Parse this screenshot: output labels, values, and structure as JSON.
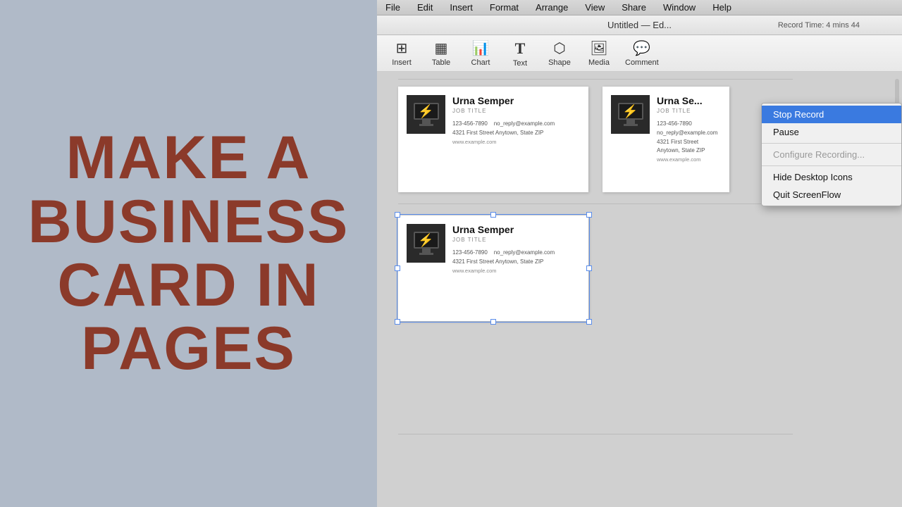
{
  "left_panel": {
    "title_line1": "MAKE A",
    "title_line2": "BUSINESS",
    "title_line3": "CARD IN",
    "title_line4": "PAGES"
  },
  "menu_bar": {
    "items": [
      "File",
      "Edit",
      "Insert",
      "Format",
      "Arrange",
      "View",
      "Share",
      "Window",
      "Help"
    ]
  },
  "title_bar": {
    "text": "Untitled — Ed...",
    "record_time": "Record Time: 4 mins 44"
  },
  "toolbar": {
    "buttons": [
      {
        "label": "Insert",
        "icon": "⊞"
      },
      {
        "label": "Table",
        "icon": "▦"
      },
      {
        "label": "Chart",
        "icon": "📊"
      },
      {
        "label": "Text",
        "icon": "T"
      },
      {
        "label": "Shape",
        "icon": "⬡"
      },
      {
        "label": "Media",
        "icon": "🖼"
      },
      {
        "label": "Comment",
        "icon": "💬"
      }
    ]
  },
  "cards": [
    {
      "name": "Urna Semper",
      "job_title": "JOB TITLE",
      "phone": "123-456-7890",
      "email": "no_reply@example.com",
      "address": "4321 First Street  Anytown, State  ZIP",
      "url": "www.example.com",
      "selected": false
    },
    {
      "name": "Urna Se...",
      "job_title": "JOB TITLE",
      "phone": "123-456-7890",
      "email": "no_reply@example.com",
      "address": "4321 First Street  Anytown, State  ZIP",
      "url": "www.example.com",
      "selected": false
    },
    {
      "name": "Urna Semper",
      "job_title": "JOB TITLE",
      "phone": "123-456-7890",
      "email": "no_reply@example.com",
      "address": "4321 First Street  Anytown, State  ZIP",
      "url": "www.example.com",
      "selected": true
    }
  ],
  "dropdown": {
    "items": [
      {
        "label": "Stop Record",
        "type": "highlighted"
      },
      {
        "label": "Pause",
        "type": "normal"
      },
      {
        "label": "separator"
      },
      {
        "label": "Configure Recording...",
        "type": "dimmed"
      },
      {
        "label": "separator"
      },
      {
        "label": "Hide Desktop Icons",
        "type": "normal"
      },
      {
        "label": "Quit ScreenFlow",
        "type": "normal"
      }
    ]
  }
}
